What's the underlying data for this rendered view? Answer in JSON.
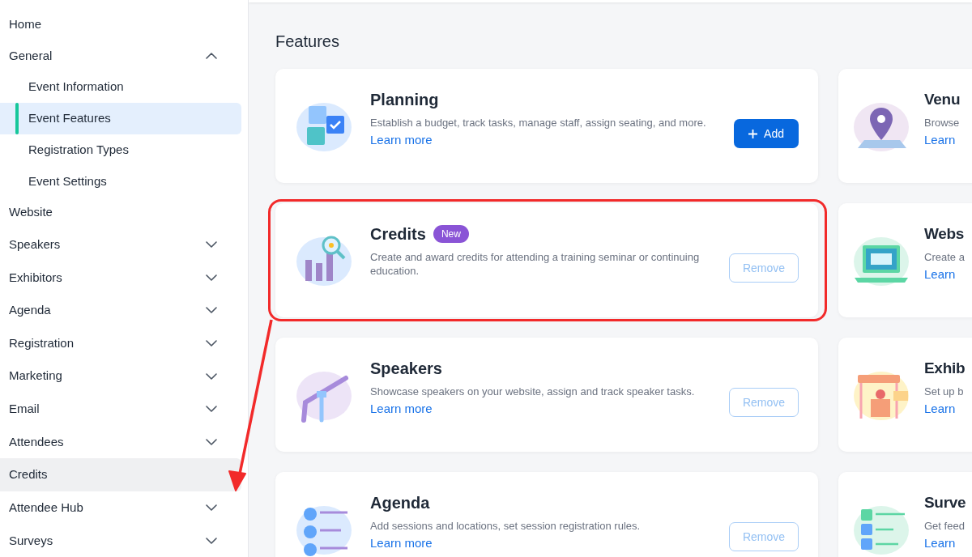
{
  "sidebar": {
    "items": [
      {
        "label": "Home",
        "selected": false,
        "hovered": false
      },
      {
        "label": "General",
        "selected": false,
        "hovered": false,
        "expanded": true,
        "children": [
          {
            "label": "Event Information",
            "selected": false,
            "hovered": false
          },
          {
            "label": "Event Features",
            "selected": true
          },
          {
            "label": "Registration Types",
            "selected": false,
            "hovered": false
          },
          {
            "label": "Event Settings",
            "selected": false,
            "hovered": false
          }
        ]
      },
      {
        "label": "Website",
        "selected": false,
        "hovered": false
      },
      {
        "label": "Speakers",
        "selected": false,
        "hovered": false,
        "expanded": false
      },
      {
        "label": "Exhibitors",
        "selected": false,
        "hovered": false,
        "expanded": false
      },
      {
        "label": "Agenda",
        "selected": false,
        "hovered": false,
        "expanded": false
      },
      {
        "label": "Registration",
        "selected": false,
        "hovered": false,
        "expanded": false
      },
      {
        "label": "Marketing",
        "selected": false,
        "hovered": false,
        "expanded": false
      },
      {
        "label": "Email",
        "selected": false,
        "hovered": false,
        "expanded": false
      },
      {
        "label": "Attendees",
        "selected": false,
        "hovered": false,
        "expanded": false
      },
      {
        "label": "Credits",
        "selected": false,
        "hovered": true
      },
      {
        "label": "Attendee Hub",
        "selected": false,
        "hovered": false,
        "expanded": false
      },
      {
        "label": "Surveys",
        "selected": false,
        "hovered": false,
        "expanded": false
      }
    ]
  },
  "heading": "Features",
  "left_column": [
    {
      "title": "Planning",
      "description": "Establish a budget, track tasks, manage staff, assign seating, and more.",
      "link": "Learn more",
      "button": {
        "kind": "add",
        "label": "Add"
      },
      "highlighted": false
    },
    {
      "title": "Credits",
      "badge": "New",
      "description": "Create and award credits for attending a training seminar or continuing education.",
      "button": {
        "kind": "remove",
        "label": "Remove"
      },
      "highlighted": true
    },
    {
      "title": "Speakers",
      "description": "Showcase speakers on your website, assign and track speaker tasks.",
      "link": "Learn more",
      "button": {
        "kind": "remove",
        "label": "Remove"
      },
      "highlighted": false
    },
    {
      "title": "Agenda",
      "description": "Add sessions and locations, set session registration rules.",
      "link": "Learn more",
      "button": {
        "kind": "remove",
        "label": "Remove"
      },
      "highlighted": false
    }
  ],
  "right_column": [
    {
      "title": "Venu",
      "description": "Browse",
      "link": "Learn"
    },
    {
      "title": "Webs",
      "description": "Create a",
      "link": "Learn"
    },
    {
      "title": "Exhib",
      "description": "Set up b",
      "link": "Learn"
    },
    {
      "title": "Surve",
      "description": "Get feed",
      "link": "Learn"
    }
  ]
}
